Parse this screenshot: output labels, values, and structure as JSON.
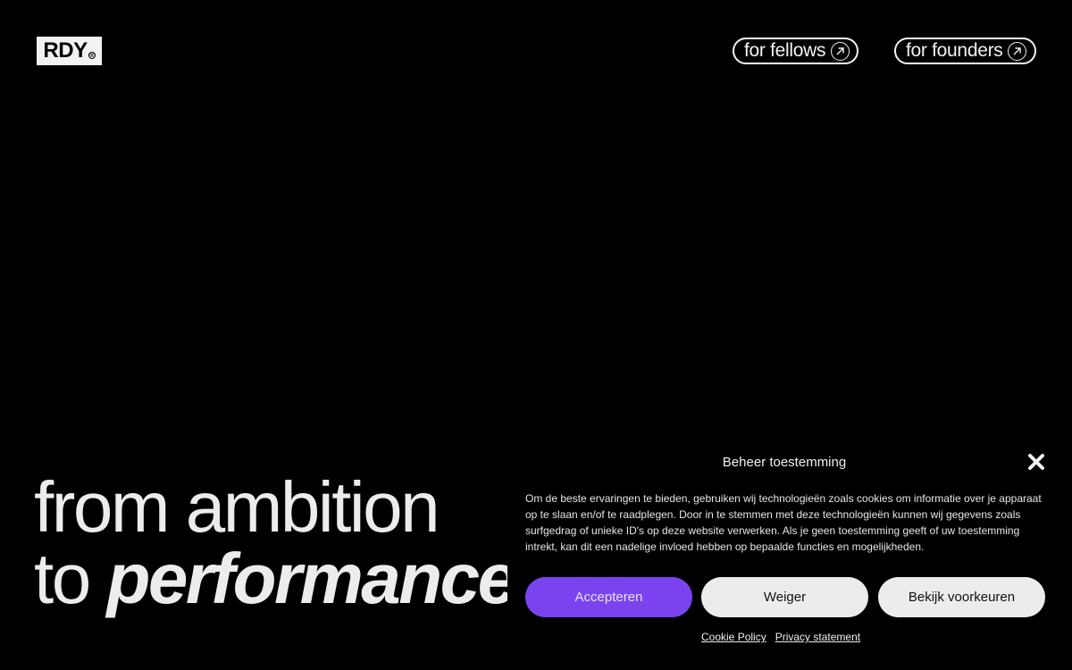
{
  "header": {
    "logo_text": "RDY",
    "logo_mark": "®",
    "nav": [
      {
        "label": "for fellows",
        "icon": "arrow-up-right-icon"
      },
      {
        "label": "for founders",
        "icon": "arrow-up-right-icon"
      }
    ]
  },
  "hero": {
    "line1": "from ambition",
    "line2_prefix": "to ",
    "line2_emphasis": "performance"
  },
  "cookie": {
    "title": "Beheer toestemming",
    "close_icon": "close-icon",
    "body": "Om de beste ervaringen te bieden, gebruiken wij technologieën zoals cookies om informatie over je apparaat op te slaan en/of te raadplegen. Door in te stemmen met deze technologieën kunnen wij gegevens zoals surfgedrag of unieke ID's op deze website verwerken. Als je geen toestemming geeft of uw toestemming intrekt, kan dit een nadelige invloed hebben op bepaalde functies en mogelijkheden.",
    "buttons": {
      "accept": "Accepteren",
      "reject": "Weiger",
      "preferences": "Bekijk voorkeuren"
    },
    "links": {
      "cookie_policy": "Cookie Policy",
      "privacy": "Privacy statement"
    }
  },
  "colors": {
    "background": "#000000",
    "accent": "#7b43f0",
    "light_button": "#ececec",
    "text": "#f2f2f2"
  }
}
